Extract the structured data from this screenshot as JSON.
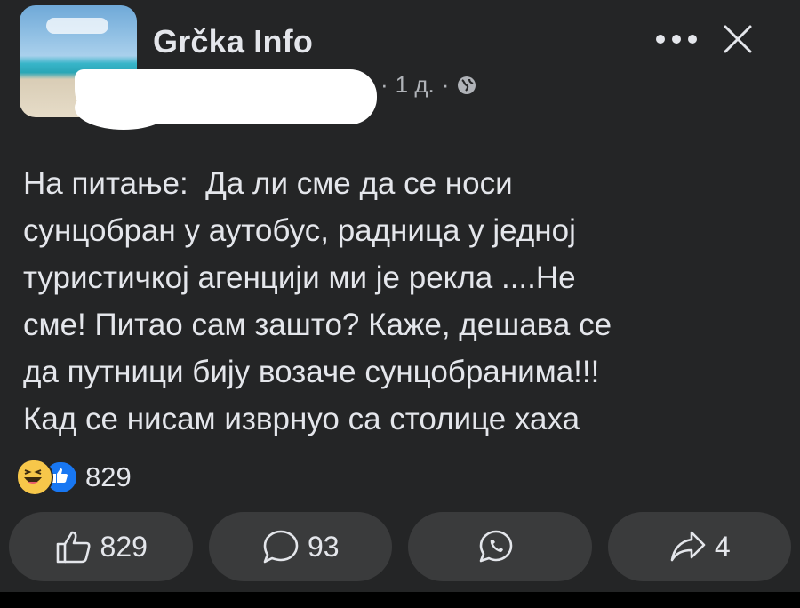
{
  "header": {
    "page_name": "Grčka Info",
    "time": "1 д.",
    "separator": "·",
    "more_icon": "more-horizontal-icon",
    "close_icon": "close-icon",
    "privacy_icon": "globe-icon"
  },
  "post": {
    "text": "На питање:  Да ли сме да се носи\nсунцобран у аутобус, радница у једној\nтуристичкој агенцији ми је рекла ....Не\nсме! Питао сам зашто? Каже, дешава се\nда путници бију возаче сунцобранима!!!\nКад се нисам изврнуо са столице хаха"
  },
  "reactions": {
    "types": [
      "haha",
      "like"
    ],
    "count": "829"
  },
  "actions": {
    "like_count": "829",
    "comment_count": "93",
    "whatsapp_label": "",
    "share_count": "4"
  },
  "colors": {
    "background": "#242526",
    "button": "#3a3b3c",
    "text": "#e4e6eb",
    "muted": "#b0b3b8",
    "like_blue": "#1877f2",
    "haha_yellow": "#f7c74a"
  }
}
